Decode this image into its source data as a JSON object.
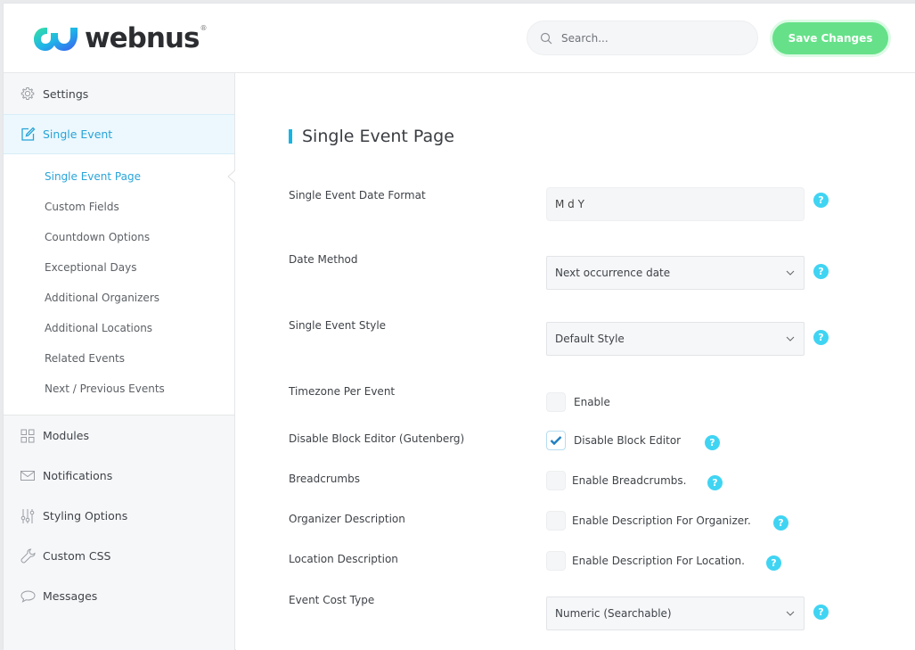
{
  "header": {
    "logo_text": "webnus",
    "logo_mark": "®",
    "search_placeholder": "Search...",
    "save_label": "Save Changes"
  },
  "colors": {
    "accent": "#27a3d8",
    "save": "#66e189",
    "help": "#40d4f3",
    "title_bar": "#14b5e5"
  },
  "sidebar": {
    "top_items": [
      {
        "label": "Settings",
        "icon": "gear-icon"
      },
      {
        "label": "Single Event",
        "icon": "edit-icon",
        "active": true
      }
    ],
    "sub_items": [
      {
        "label": "Single Event Page",
        "active": true
      },
      {
        "label": "Custom Fields"
      },
      {
        "label": "Countdown Options"
      },
      {
        "label": "Exceptional Days"
      },
      {
        "label": "Additional Organizers"
      },
      {
        "label": "Additional Locations"
      },
      {
        "label": "Related Events"
      },
      {
        "label": "Next / Previous Events"
      }
    ],
    "lower_items": [
      {
        "label": "Modules",
        "icon": "grid-icon"
      },
      {
        "label": "Notifications",
        "icon": "envelope-icon"
      },
      {
        "label": "Styling Options",
        "icon": "sliders-icon"
      },
      {
        "label": "Custom CSS",
        "icon": "wrench-icon"
      },
      {
        "label": "Messages",
        "icon": "chat-bubble-icon"
      }
    ]
  },
  "main": {
    "title": "Single Event Page",
    "help_glyph": "?",
    "fields": {
      "date_format": {
        "label": "Single Event Date Format",
        "value": "M d Y"
      },
      "date_method": {
        "label": "Date Method",
        "value": "Next occurrence date"
      },
      "event_style": {
        "label": "Single Event Style",
        "value": "Default Style"
      },
      "timezone": {
        "label": "Timezone Per Event",
        "option": "Enable",
        "checked": false
      },
      "block_editor": {
        "label": "Disable Block Editor (Gutenberg)",
        "option": "Disable Block Editor",
        "checked": true
      },
      "breadcrumbs": {
        "label": "Breadcrumbs",
        "option": "Enable Breadcrumbs.",
        "checked": false
      },
      "organizer_desc": {
        "label": "Organizer Description",
        "option": "Enable Description For Organizer.",
        "checked": false
      },
      "location_desc": {
        "label": "Location Description",
        "option": "Enable Description For Location.",
        "checked": false
      },
      "cost_type": {
        "label": "Event Cost Type",
        "value": "Numeric (Searchable)"
      }
    }
  }
}
